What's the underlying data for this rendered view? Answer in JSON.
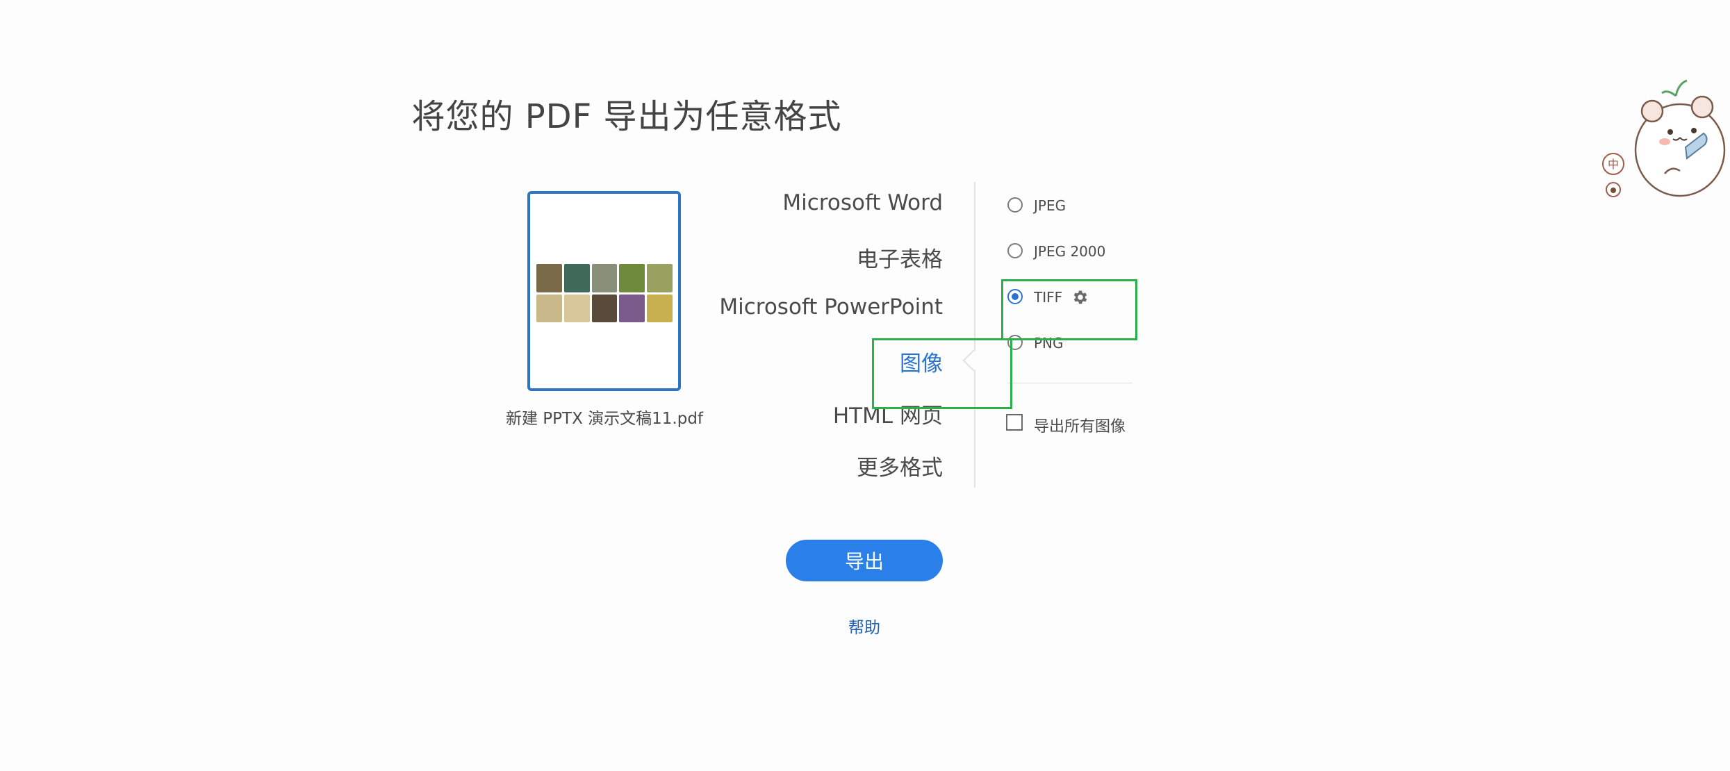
{
  "title": "将您的 PDF 导出为任意格式",
  "file": {
    "name": "新建 PPTX 演示文稿11.pdf",
    "thumbnail_tiles": [
      "#7a6a4a",
      "#3f6a5a",
      "#8a8f7a",
      "#6f8a3a",
      "#9aa060",
      "#c9b98a",
      "#d8c79a",
      "#5a4a3a",
      "#7a5a8a",
      "#c8b050"
    ]
  },
  "categories": [
    {
      "label": "Microsoft Word",
      "active": false
    },
    {
      "label": "电子表格",
      "active": false
    },
    {
      "label": "Microsoft PowerPoint",
      "active": false
    },
    {
      "label": "图像",
      "active": true
    },
    {
      "label": "HTML 网页",
      "active": false
    },
    {
      "label": "更多格式",
      "active": false
    }
  ],
  "image_options": [
    {
      "label": "JPEG",
      "checked": false
    },
    {
      "label": "JPEG 2000",
      "checked": false
    },
    {
      "label": "TIFF",
      "checked": true
    },
    {
      "label": "PNG",
      "checked": false
    }
  ],
  "export_all_images": {
    "label": "导出所有图像",
    "checked": false
  },
  "export_button": "导出",
  "help_link": "帮助",
  "sticker_glyph": "中",
  "colors": {
    "accent": "#2a80e8",
    "active_category": "#2a74d0",
    "highlight": "#2cb04a",
    "thumbnail_border": "#2d74c4"
  },
  "icons": {
    "settings": "gear-icon"
  }
}
